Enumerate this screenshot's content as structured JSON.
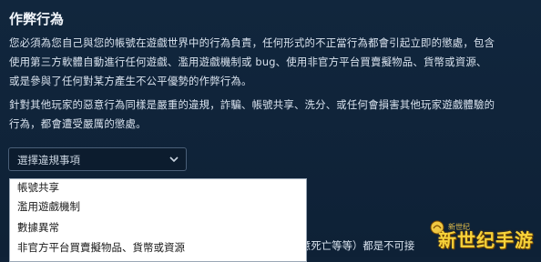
{
  "section": {
    "title": "作弊行為",
    "paragraph1_line1": "您必須為您自己與您的帳號在遊戲世界中的行為負責，任何形式的不正當行為都會引起立即的懲處，包含",
    "paragraph1_line2": "使用第三方軟體自動進行任何遊戲、濫用遊戲機制或 bug、使用非官方平台買賣擬物品、貨幣或資源、",
    "paragraph1_line3": "或是參與了任何對某方產生不公平優勢的作弊行為。",
    "paragraph2_line1": "針對其他玩家的惡意行為同樣是嚴重的違規，詐騙、帳號共享、洗分、或任何會損害其他玩家遊戲體驗的",
    "paragraph2_line2": "行為，都會遭受嚴厲的懲處。"
  },
  "violation_select": {
    "placeholder": "選擇違規事項",
    "options": [
      "帳號共享",
      "濫用遊戲機制",
      "數據異常",
      "非官方平台買賣擬物品、貨幣或資源"
    ]
  },
  "obscured_text": {
    "line1": "意死亡等等）都是不可接"
  },
  "watermark": {
    "text": "新世纪手游",
    "small": "新世纪"
  }
}
